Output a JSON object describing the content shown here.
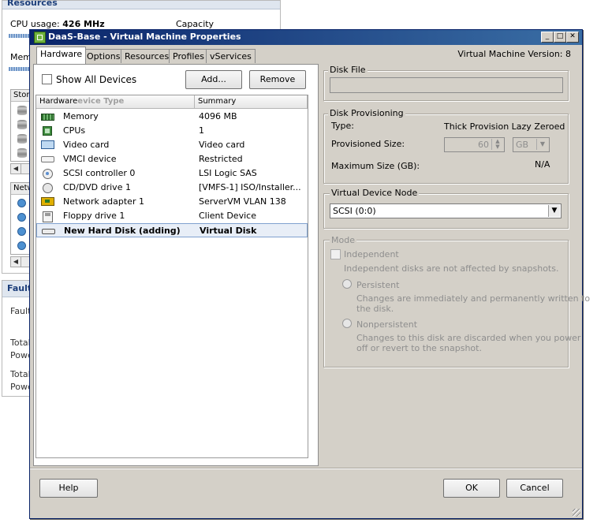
{
  "background": {
    "resources_title": "Resources",
    "cpu_label": "CPU usage:",
    "cpu_value": "426 MHz",
    "capacity_label": "Capacity",
    "memory_label": "Memo",
    "storage_header": "Stor",
    "network_header": "Netw",
    "fault_title": "Fault",
    "fault_label": "Fault",
    "total_1": "Total",
    "power_1": "Powe",
    "total_2": "Total",
    "power_2": "Powe"
  },
  "dialog": {
    "title": "DaaS-Base - Virtual Machine Properties",
    "tabs": [
      "Hardware",
      "Options",
      "Resources",
      "Profiles",
      "vServices"
    ],
    "active_tab": "Hardware",
    "vm_version": "Virtual Machine Version: 8",
    "show_all_devices": "Show All Devices",
    "add_button": "Add...",
    "remove_button": "Remove",
    "columns": {
      "hardware": "Hardware",
      "hardware_ghost": "evice Type",
      "summary": "Summary"
    },
    "devices": [
      {
        "name": "Memory",
        "summary": "4096 MB",
        "icon": "memory-icon"
      },
      {
        "name": "CPUs",
        "summary": "1",
        "icon": "cpu-icon"
      },
      {
        "name": "Video card",
        "summary": "Video card",
        "icon": "video-card-icon"
      },
      {
        "name": "VMCI device",
        "summary": "Restricted",
        "icon": "vmci-icon"
      },
      {
        "name": "SCSI controller 0",
        "summary": "LSI Logic SAS",
        "icon": "scsi-controller-icon"
      },
      {
        "name": "CD/DVD drive 1",
        "summary": "[VMFS-1] ISO/Installer...",
        "icon": "cd-dvd-icon"
      },
      {
        "name": "Network adapter 1",
        "summary": "ServerVM VLAN 138",
        "icon": "network-adapter-icon"
      },
      {
        "name": "Floppy drive 1",
        "summary": "Client Device",
        "icon": "floppy-icon"
      },
      {
        "name": "New Hard Disk (adding)",
        "summary": "Virtual Disk",
        "icon": "hard-disk-icon",
        "selected": true
      }
    ],
    "disk_file": {
      "legend": "Disk File",
      "value": ""
    },
    "disk_provisioning": {
      "legend": "Disk Provisioning",
      "type_label": "Type:",
      "type_value": "Thick Provision Lazy Zeroed",
      "size_label": "Provisioned Size:",
      "size_value": "60",
      "size_unit": "GB",
      "max_label": "Maximum Size (GB):",
      "max_value": "N/A"
    },
    "virtual_device_node": {
      "legend": "Virtual Device Node",
      "selected": "SCSI (0:0)"
    },
    "mode": {
      "legend": "Mode",
      "independent_label": "Independent",
      "independent_desc": "Independent disks are not affected by snapshots.",
      "persistent_label": "Persistent",
      "persistent_desc_1": "Changes are immediately and permanently written to",
      "persistent_desc_2": "the disk.",
      "nonpersistent_label": "Nonpersistent",
      "nonpersistent_desc_1": "Changes to this disk are discarded when you power",
      "nonpersistent_desc_2": "off or revert to the snapshot."
    },
    "help_button": "Help",
    "ok_button": "OK",
    "cancel_button": "Cancel",
    "title_buttons": {
      "minimize": "_",
      "maximize": "□",
      "close": "✕"
    }
  }
}
